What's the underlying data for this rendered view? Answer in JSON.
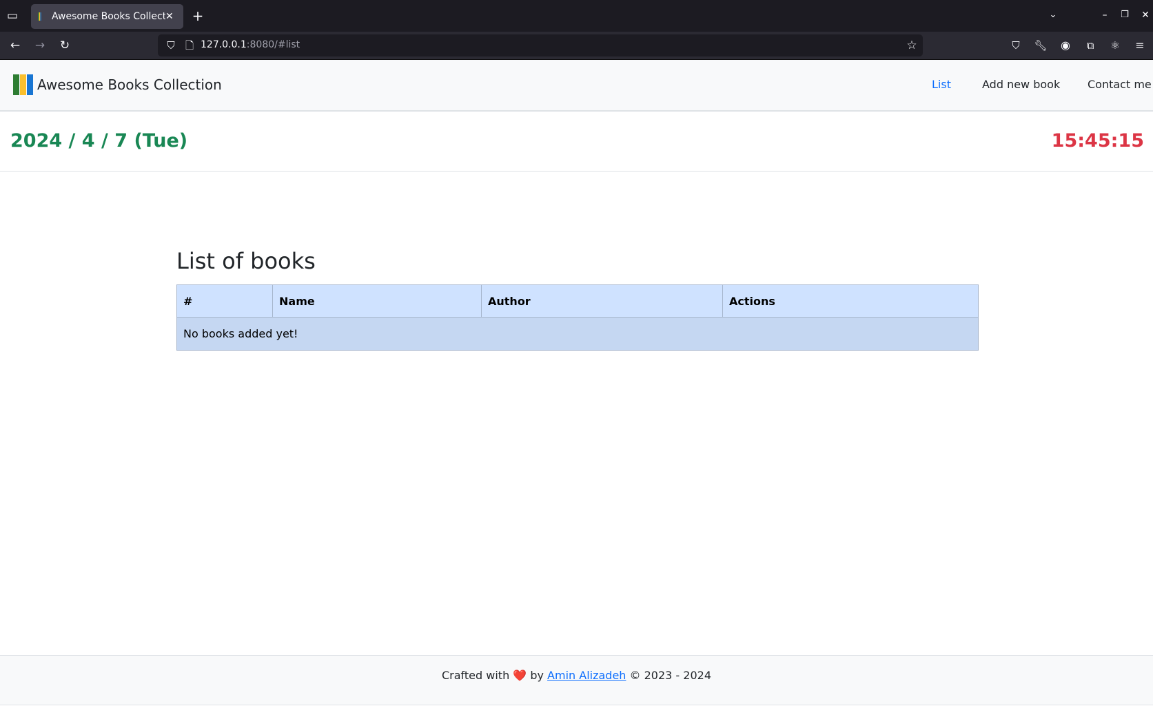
{
  "browser": {
    "tab_title": "Awesome Books Collection",
    "url_host": "127.0.0.1",
    "url_rest": ":8080/#list"
  },
  "nav": {
    "brand": "Awesome Books Collection",
    "links": [
      {
        "label": "List",
        "active": true
      },
      {
        "label": "Add new book"
      },
      {
        "label": "Contact me"
      }
    ]
  },
  "datetime": {
    "date": "2024 / 4 / 7 (Tue)",
    "time": "15:45:15"
  },
  "main": {
    "title": "List of books",
    "columns": [
      "#",
      "Name",
      "Author",
      "Actions"
    ],
    "empty_message": "No books added yet!"
  },
  "footer": {
    "prefix": "Crafted with",
    "heart": "❤️",
    "by": "by",
    "author": "Amin Alizadeh",
    "suffix": "© 2023 - 2024"
  },
  "colors": {
    "accent": "#0d6efd",
    "date": "#198754",
    "time": "#dc3545",
    "table_header": "#cfe2ff",
    "table_row": "#c5d7f2"
  }
}
